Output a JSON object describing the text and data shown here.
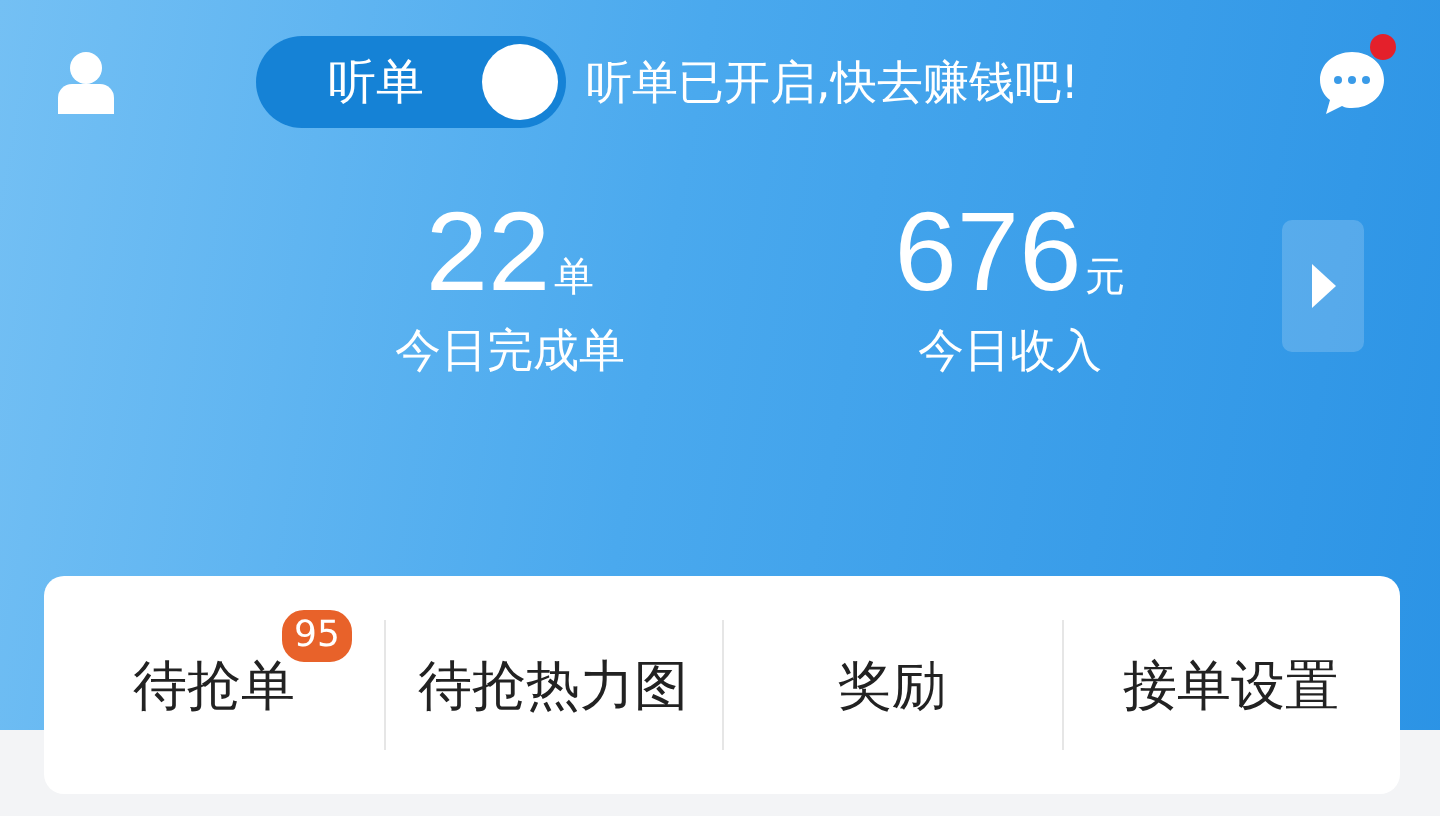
{
  "top_bar": {
    "listen_toggle": {
      "label": "听单",
      "on": true
    },
    "status_text": "听单已开启,快去赚钱吧!",
    "messages": {
      "unread": true
    }
  },
  "stats": [
    {
      "value": "22",
      "unit": "单",
      "label": "今日完成单"
    },
    {
      "value": "676",
      "unit": "元",
      "label": "今日收入"
    }
  ],
  "menu": [
    {
      "label": "待抢单",
      "badge": "95"
    },
    {
      "label": "待抢热力图"
    },
    {
      "label": "奖励"
    },
    {
      "label": "接单设置"
    }
  ]
}
